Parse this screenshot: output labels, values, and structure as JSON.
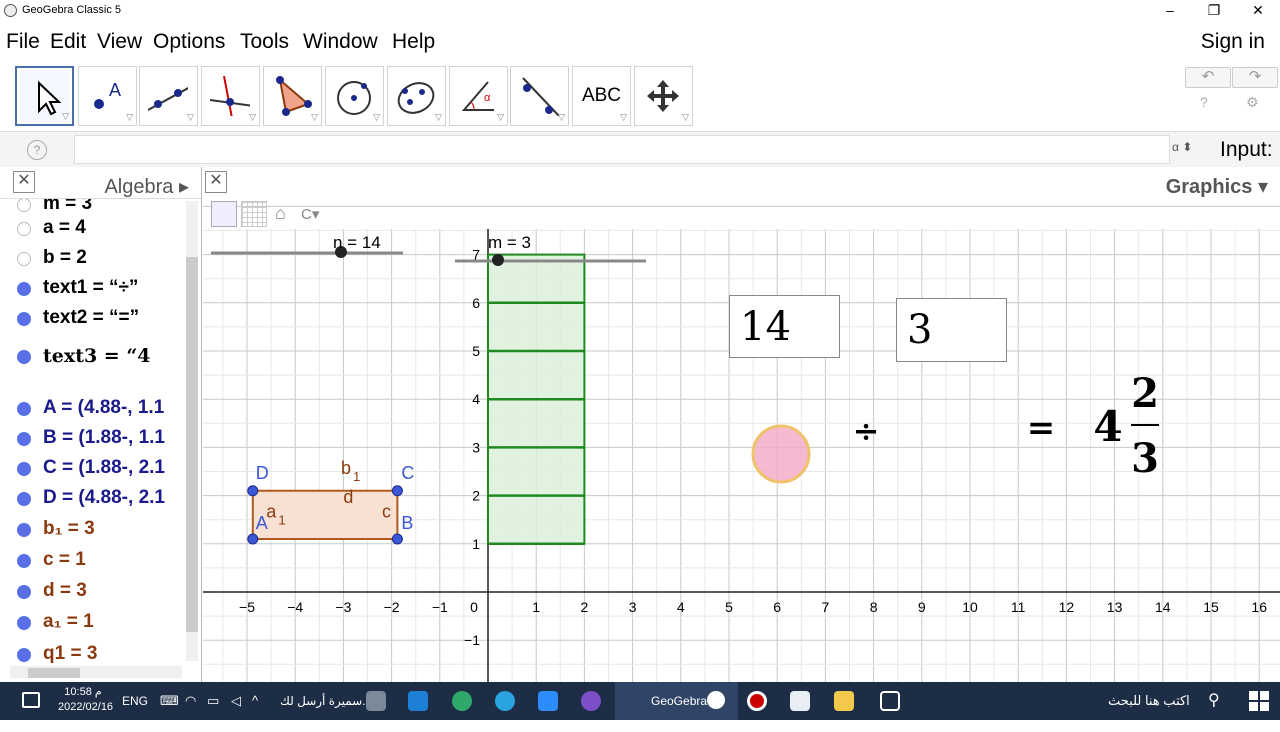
{
  "window": {
    "title": "GeoGebra Classic 5",
    "minimize": "–",
    "restore": "❐",
    "close": "✕"
  },
  "menu": {
    "items": [
      "File",
      "Edit",
      "View",
      "Options",
      "Tools",
      "Window",
      "Help"
    ],
    "sign_in": "Sign in"
  },
  "toolbar": {
    "tools": [
      "move-tool",
      "point-tool",
      "line-tool",
      "perpendicular-line-tool",
      "polygon-tool",
      "circle-tool",
      "conic-tool",
      "angle-tool",
      "reflect-tool",
      "text-tool",
      "move-graphics-view-tool"
    ],
    "text_tool_label": "ABC",
    "undo": "↶",
    "redo": "↷",
    "help": "?",
    "settings": "⚙"
  },
  "input_bar": {
    "help": "?",
    "alpha": "α ⬍",
    "label": "Input:",
    "value": ""
  },
  "algebra": {
    "title": "Algebra",
    "close": "✕",
    "expand": "▸",
    "items": [
      {
        "text": "m = 3",
        "color": "#000000",
        "shown": false
      },
      {
        "text": "a = 4",
        "color": "#000000",
        "shown": false
      },
      {
        "text": "b = 2",
        "color": "#000000",
        "shown": false
      },
      {
        "text": "text1 = “÷”",
        "color": "#000000",
        "shown": true
      },
      {
        "text": "text2 = “=”",
        "color": "#000000",
        "shown": true
      },
      {
        "text": "text3 = “4",
        "color": "#000000",
        "shown": true,
        "serif": true
      },
      {
        "text": "A = (4.88-, 1.1",
        "color": "#1a1a8c",
        "shown": true
      },
      {
        "text": "B = (1.88-, 1.1",
        "color": "#1a1a8c",
        "shown": true
      },
      {
        "text": "C = (1.88-, 2.1",
        "color": "#1a1a8c",
        "shown": true
      },
      {
        "text": "D = (4.88-, 2.1",
        "color": "#1a1a8c",
        "shown": true
      },
      {
        "text": "b₁ = 3",
        "color": "#8b3a0f",
        "shown": true
      },
      {
        "text": "c = 1",
        "color": "#8b3a0f",
        "shown": true
      },
      {
        "text": "d = 3",
        "color": "#8b3a0f",
        "shown": true
      },
      {
        "text": "a₁ = 1",
        "color": "#8b3a0f",
        "shown": true
      },
      {
        "text": "q1 = 3",
        "color": "#8b3a0f",
        "shown": true
      }
    ]
  },
  "graphics": {
    "title": "Graphics",
    "close": "✕",
    "menu_arrow": "▾",
    "home": "⌂",
    "chart_data": {
      "type": "scatter",
      "xlim": [
        -5.8,
        16.5
      ],
      "ylim": [
        -1.8,
        7.5
      ],
      "x_ticks": [
        -5,
        -4,
        -3,
        -2,
        -1,
        0,
        1,
        2,
        3,
        4,
        5,
        6,
        7,
        8,
        9,
        10,
        11,
        12,
        13,
        14,
        15,
        16
      ],
      "y_ticks": [
        -1,
        1,
        2,
        3,
        4,
        5,
        6,
        7
      ],
      "grid": true
    },
    "slider_n": {
      "label": "n = 14",
      "value": 14
    },
    "slider_m": {
      "label": "m = 3",
      "value": 3
    },
    "points": [
      {
        "name": "A",
        "x": -4.88,
        "y": 1.1
      },
      {
        "name": "B",
        "x": -1.88,
        "y": 1.1
      },
      {
        "name": "C",
        "x": -1.88,
        "y": 2.1
      },
      {
        "name": "D",
        "x": -4.88,
        "y": 2.1
      }
    ],
    "segment_labels": {
      "top": "b",
      "top_sub": "1",
      "left": "a",
      "left_sub": "1",
      "right": "c",
      "inner": "d"
    },
    "green_bars": {
      "x_from": 0,
      "x_to": 2,
      "rows": [
        1,
        2,
        3,
        4,
        5,
        6
      ],
      "top": 7
    },
    "box1": "14",
    "box2": "3",
    "divide": "÷",
    "equals": "=",
    "mixed_whole": "4",
    "mixed_num": "2",
    "mixed_den": "3",
    "colors": {
      "green": "#1f8a1f",
      "green_fill": "#d9efd9",
      "orange": "#b05a1f",
      "orange_fill": "#f7e1d3",
      "point_blue": "#3b57d6",
      "cursor_pink": "#f2a7c6"
    }
  },
  "taskbar": {
    "time": "10:58 م",
    "date": "2022/02/16",
    "lang": "ENG",
    "notify_text": "سميرة أرسل لك...",
    "app_label": "GeoGebra",
    "search_text": "اكتب هنا للبحث"
  }
}
